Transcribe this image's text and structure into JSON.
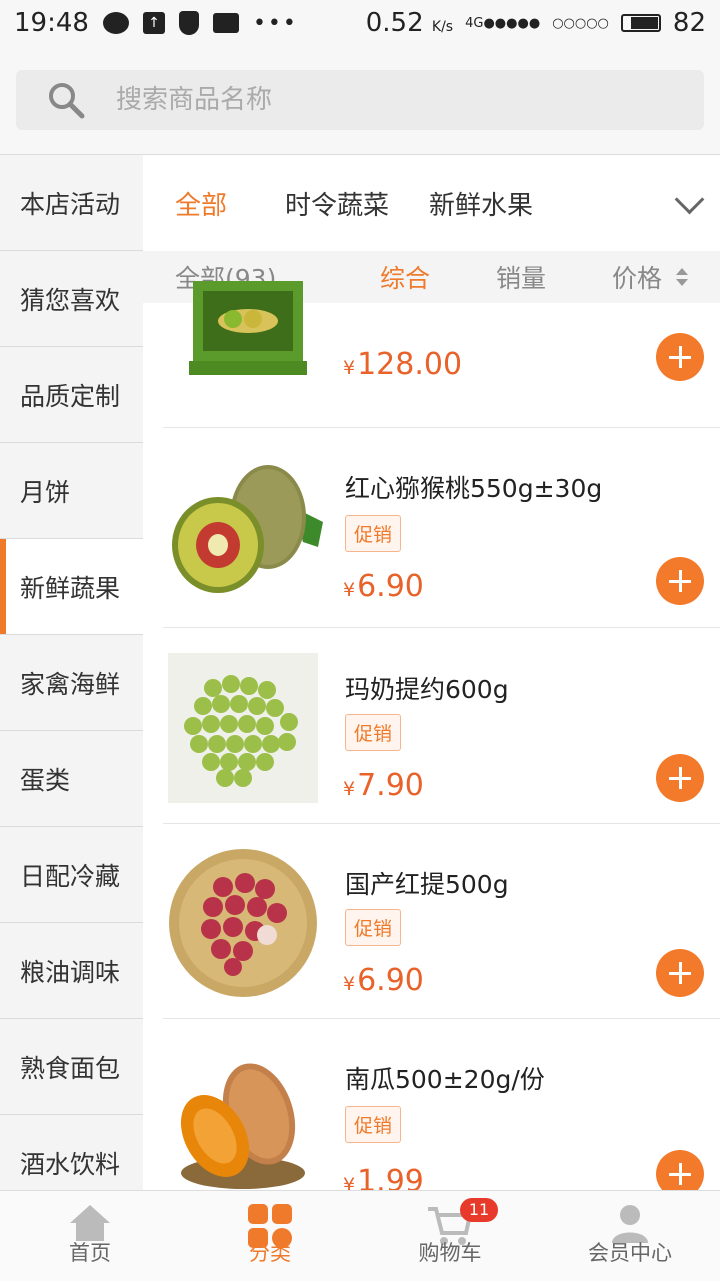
{
  "status_bar": {
    "time": "19:48",
    "speed": "0.52",
    "speed_unit": "K/s",
    "network": "4G",
    "battery": "82"
  },
  "search": {
    "placeholder": "搜索商品名称"
  },
  "sidebar": {
    "items": [
      {
        "label": "本店活动"
      },
      {
        "label": "猜您喜欢"
      },
      {
        "label": "品质定制"
      },
      {
        "label": "月饼"
      },
      {
        "label": "新鲜蔬果",
        "active": true
      },
      {
        "label": "家禽海鲜"
      },
      {
        "label": "蛋类"
      },
      {
        "label": "日配冷藏"
      },
      {
        "label": "粮油调味"
      },
      {
        "label": "熟食面包"
      },
      {
        "label": "酒水饮料"
      }
    ]
  },
  "tabs": {
    "items": [
      {
        "label": "全部",
        "active": true
      },
      {
        "label": "时令蔬菜"
      },
      {
        "label": "新鲜水果"
      }
    ]
  },
  "sort": {
    "all_label": "全部(93)",
    "comprehensive": "综合",
    "sales": "销量",
    "price": "价格"
  },
  "products": [
    {
      "name": "",
      "price": "128.00",
      "tag": ""
    },
    {
      "name": "红心猕猴桃550g±30g",
      "tag": "促销",
      "price": "6.90"
    },
    {
      "name": "玛奶提约600g",
      "tag": "促销",
      "price": "7.90"
    },
    {
      "name": "国产红提500g",
      "tag": "促销",
      "price": "6.90"
    },
    {
      "name": "南瓜500±20g/份",
      "tag": "促销",
      "price": "1.99"
    }
  ],
  "currency_symbol": "¥",
  "bottom_nav": {
    "home": "首页",
    "category": "分类",
    "cart": "购物车",
    "cart_count": "11",
    "member": "会员中心"
  },
  "colors": {
    "accent": "#f07a2b",
    "price": "#e8622a",
    "badge": "#e83a2a"
  }
}
